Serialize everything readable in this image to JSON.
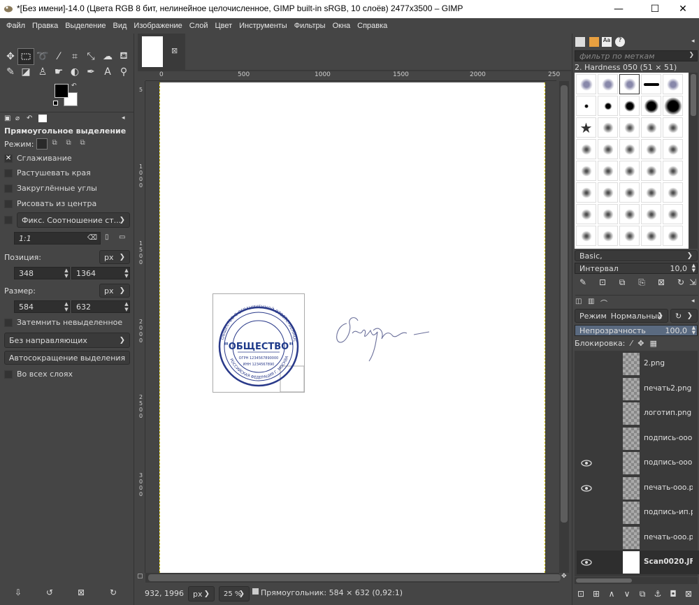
{
  "window": {
    "title": "*[Без имени]-14.0 (Цвета RGB 8 бит, нелинейное целочисленное, GIMP built-in sRGB, 10 слоёв) 2477x3500 – GIMP",
    "minimize": "—",
    "maximize": "☐",
    "close": "✕"
  },
  "menu": [
    "Файл",
    "Правка",
    "Выделение",
    "Вид",
    "Изображение",
    "Слой",
    "Цвет",
    "Инструменты",
    "Фильтры",
    "Окна",
    "Справка"
  ],
  "tool_options": {
    "title": "Прямоугольное выделение",
    "mode_label": "Режим:",
    "antialias": "Сглаживание",
    "feather": "Растушевать края",
    "rounded": "Закруглённые углы",
    "from_center": "Рисовать из центра",
    "fixed": "Фикс. Соотношение ст...",
    "ratio": "1:1",
    "position_label": "Позиция:",
    "position_unit": "px",
    "pos_x": "348",
    "pos_y": "1364",
    "size_label": "Размер:",
    "size_unit": "px",
    "size_w": "584",
    "size_h": "632",
    "highlight": "Затемнить невыделенное",
    "guides": "Без направляющих",
    "autoshrink": "Автосокращение выделения",
    "all_layers": "Во всех слоях"
  },
  "rulers": {
    "top": [
      "0",
      "500",
      "1000",
      "1500",
      "2000",
      "250"
    ],
    "left": [
      "5",
      "1",
      "0",
      "0",
      "0",
      "1",
      "5",
      "0",
      "0",
      "2",
      "0",
      "0",
      "0",
      "2",
      "5",
      "0",
      "0",
      "3",
      "0",
      "0",
      "0"
    ]
  },
  "stamp": {
    "org": "\"ОБЩЕСТВО\"",
    "ogrn": "ОГРН 1234567890000",
    "inn": "ИНН 1234567890",
    "ring_top": "ОБЩЕСТВО С ОГРАНИЧЕННОЙ ОТВЕТСТВЕННОСТЬЮ",
    "ring_bottom": "РОССИЙСКАЯ ФЕДЕРАЦИЯ Г. МОСКВА"
  },
  "status": {
    "coords": "932, 1996",
    "unit": "px",
    "zoom": "25 %",
    "message": "Прямоугольник: 584 × 632  (0,92:1)"
  },
  "brushes": {
    "filter_placeholder": "фильтр по меткам",
    "current": "2. Hardness 050 (51 × 51)",
    "preset": "Basic,",
    "spacing_label": "Интервал",
    "spacing_value": "10,0"
  },
  "layers": {
    "mode_label": "Режим",
    "mode_value": "Нормальный",
    "opacity_label": "Непрозрачность",
    "opacity_value": "100,0",
    "lock_label": "Блокировка:",
    "items": [
      {
        "name": "2.png",
        "visible": false
      },
      {
        "name": "печать2.png",
        "visible": false
      },
      {
        "name": "логотип.png",
        "visible": false
      },
      {
        "name": "подпись-ооо",
        "visible": false
      },
      {
        "name": "подпись-ооо",
        "visible": true
      },
      {
        "name": "печать-ооо.р",
        "visible": true
      },
      {
        "name": "подпись-ип.р",
        "visible": false
      },
      {
        "name": "печать-ооо.р",
        "visible": false
      },
      {
        "name": "Scan0020.JF",
        "visible": true
      }
    ]
  },
  "colors": {
    "fg": "#000000",
    "bg": "#ffffff",
    "stamp_blue": "#2a3a8a"
  }
}
